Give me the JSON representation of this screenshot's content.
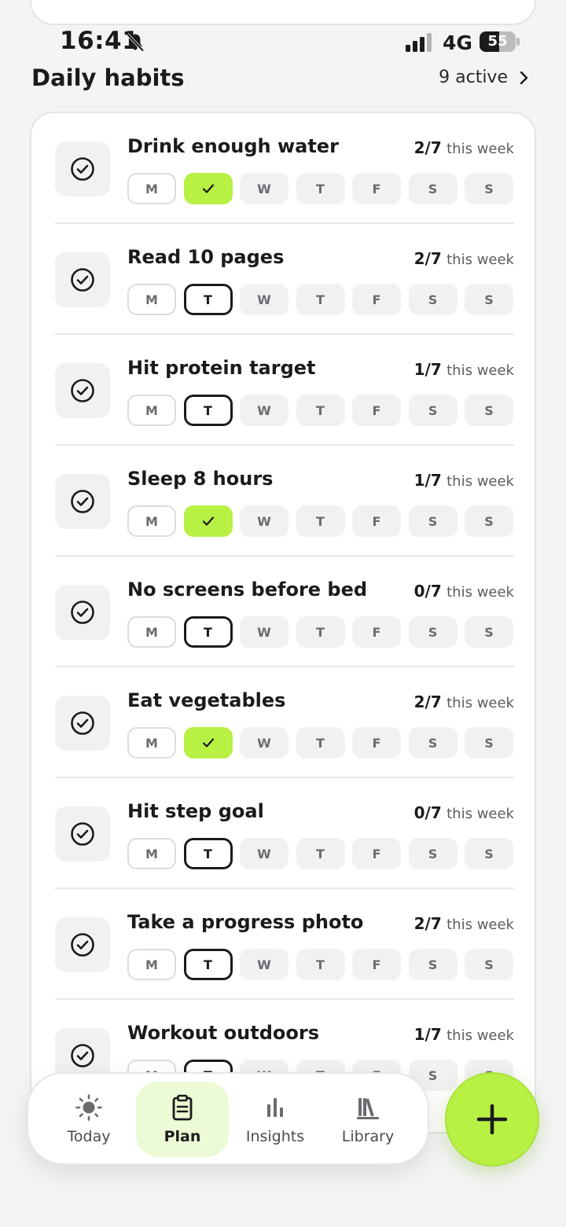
{
  "status_bar": {
    "time": "16:41",
    "network": "4G",
    "battery_level": "55"
  },
  "header": {
    "title": "Daily habits",
    "active_label": "9 active"
  },
  "day_labels": [
    "M",
    "T",
    "W",
    "T",
    "F",
    "S",
    "S"
  ],
  "progress_suffix": "this week",
  "habits": [
    {
      "name": "Drink enough water",
      "count": "2/7",
      "tuesday": "done"
    },
    {
      "name": "Read 10 pages",
      "count": "2/7",
      "tuesday": "today"
    },
    {
      "name": "Hit protein target",
      "count": "1/7",
      "tuesday": "today"
    },
    {
      "name": "Sleep 8 hours",
      "count": "1/7",
      "tuesday": "done"
    },
    {
      "name": "No screens before bed",
      "count": "0/7",
      "tuesday": "today"
    },
    {
      "name": "Eat vegetables",
      "count": "2/7",
      "tuesday": "done"
    },
    {
      "name": "Hit step goal",
      "count": "0/7",
      "tuesday": "today"
    },
    {
      "name": "Take a progress photo",
      "count": "2/7",
      "tuesday": "today"
    },
    {
      "name": "Workout outdoors",
      "count": "1/7",
      "tuesday": "today"
    }
  ],
  "bottom_nav": {
    "items": [
      {
        "label": "Today",
        "icon": "sun-icon",
        "active": false
      },
      {
        "label": "Plan",
        "icon": "clipboard-icon",
        "active": true
      },
      {
        "label": "Insights",
        "icon": "bar-chart-icon",
        "active": false
      },
      {
        "label": "Library",
        "icon": "library-icon",
        "active": false
      }
    ]
  },
  "fab": {
    "icon": "plus-icon"
  },
  "colors": {
    "accent": "#b8f044",
    "accent_soft": "#ecfad5",
    "text": "#1b1b1d",
    "background": "#f3f4f6"
  }
}
